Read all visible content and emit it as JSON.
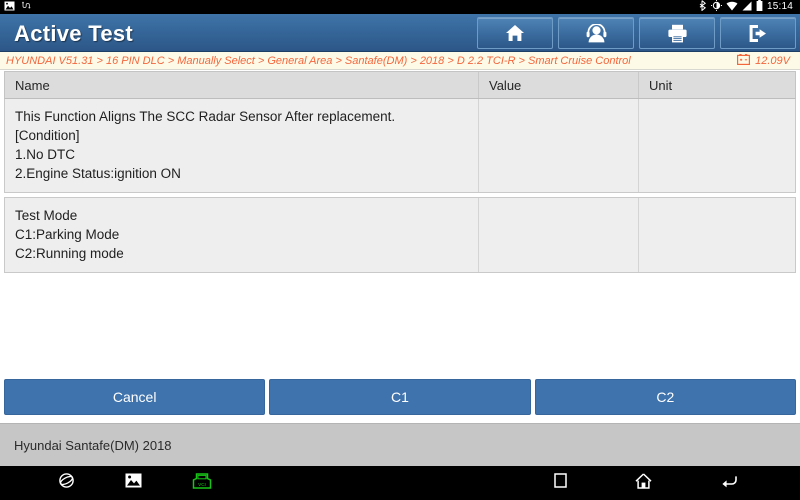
{
  "system_status_bar": {
    "icons_left": [
      "gallery-icon",
      "usb-debug-icon"
    ],
    "icons_right": [
      "bluetooth-icon",
      "brightness-icon",
      "wifi-icon",
      "signal-icon",
      "battery-icon"
    ],
    "time": "15:14"
  },
  "header": {
    "title": "Active Test",
    "toolbar": [
      {
        "name": "home-button",
        "icon": "home-icon"
      },
      {
        "name": "support-button",
        "icon": "headset-icon"
      },
      {
        "name": "print-button",
        "icon": "printer-icon"
      },
      {
        "name": "exit-button",
        "icon": "exit-icon"
      }
    ]
  },
  "breadcrumb": {
    "text": "HYUNDAI V51.31 > 16 PIN DLC > Manually Select > General Area > Santafe(DM) > 2018 > D 2.2 TCI-R > Smart Cruise Control",
    "voltage_icon": "car-battery-icon",
    "voltage": "12.09V"
  },
  "table": {
    "columns": [
      "Name",
      "Value",
      "Unit"
    ],
    "rows": [
      {
        "name_lines": [
          "This Function Aligns The SCC Radar Sensor After replacement.",
          "[Condition]",
          "1.No DTC",
          "2.Engine Status:ignition ON"
        ],
        "value": "",
        "unit": ""
      },
      {
        "name_lines": [
          "Test Mode",
          "C1:Parking Mode",
          "C2:Running mode"
        ],
        "value": "",
        "unit": ""
      }
    ]
  },
  "action_buttons": [
    {
      "name": "cancel-button",
      "label": "Cancel"
    },
    {
      "name": "c1-button",
      "label": "C1"
    },
    {
      "name": "c2-button",
      "label": "C2"
    }
  ],
  "footer": {
    "vehicle": "Hyundai Santafe(DM) 2018"
  },
  "navbar": {
    "left": [
      "browser-icon",
      "gallery-icon",
      "vci-icon"
    ],
    "right": [
      "recents-icon",
      "home-icon",
      "back-icon"
    ]
  },
  "colors": {
    "header_blue": "#36679a",
    "accent_orange": "#f4663c",
    "button_blue": "#3f73ad",
    "vci_green": "#19c419"
  }
}
